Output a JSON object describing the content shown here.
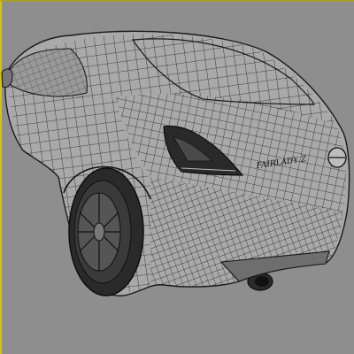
{
  "scene": {
    "subject": "wireframe-sports-car-rear-three-quarter",
    "rear_badge_text": "FAIRLADY Z",
    "viewport_frame_color": "#d9c400",
    "background_color": "#8e8e8e",
    "mesh_line_color": "#1f1f1f"
  }
}
